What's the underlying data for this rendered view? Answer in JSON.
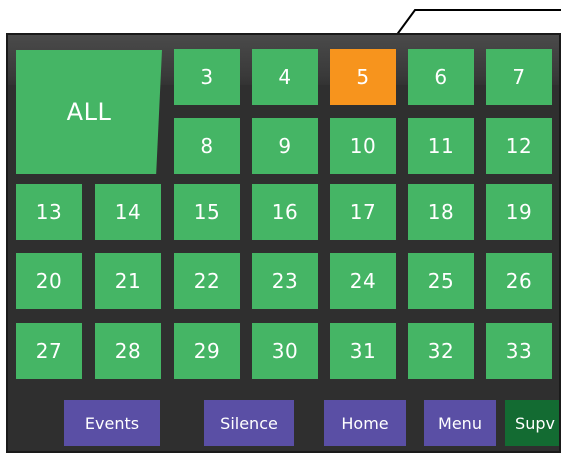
{
  "zones": {
    "all": "ALL",
    "z3": "3",
    "z4": "4",
    "z5": "5",
    "z6": "6",
    "z7": "7",
    "z8": "8",
    "z9": "9",
    "z10": "10",
    "z11": "11",
    "z12": "12",
    "z13": "13",
    "z14": "14",
    "z15": "15",
    "z16": "16",
    "z17": "17",
    "z18": "18",
    "z19": "19",
    "z20": "20",
    "z21": "21",
    "z22": "22",
    "z23": "23",
    "z24": "24",
    "z25": "25",
    "z26": "26",
    "z27": "27",
    "z28": "28",
    "z29": "29",
    "z30": "30",
    "z31": "31",
    "z32": "32",
    "z33": "33"
  },
  "selected_zone": "5",
  "nav": {
    "events": "Events",
    "silence": "Silence",
    "home": "Home",
    "menu": "Menu",
    "supv": "Supv"
  },
  "colors": {
    "zone_green": "#45b565",
    "zone_selected_orange": "#f7941d",
    "nav_purple": "#5a4fa5",
    "supv_dark_green": "#136b32",
    "panel_dark": "#2f2f2f"
  }
}
